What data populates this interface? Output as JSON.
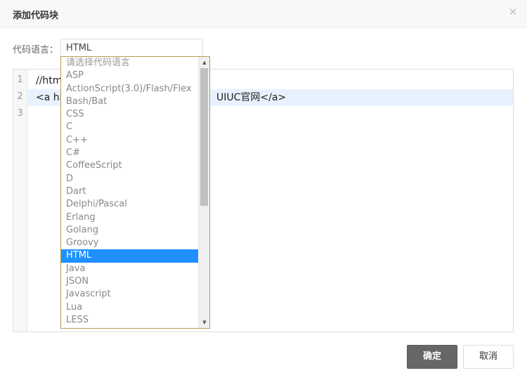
{
  "dialog": {
    "title": "添加代码块",
    "close_glyph": "✕"
  },
  "language": {
    "label": "代码语言：",
    "selected_value": "HTML"
  },
  "editor": {
    "line_numbers": [
      "1",
      "2",
      "3"
    ],
    "lines": [
      "//htm",
      "<a hr",
      ""
    ],
    "line2_tail": "UIUC官网</a>"
  },
  "dropdown": {
    "placeholder": "请选择代码语言",
    "options": [
      "ASP",
      "ActionScript(3.0)/Flash/Flex",
      "Bash/Bat",
      "CSS",
      "C",
      "C++",
      "C#",
      "CoffeeScript",
      "D",
      "Dart",
      "Delphi/Pascal",
      "Erlang",
      "Golang",
      "Groovy",
      "HTML",
      "Java",
      "JSON",
      "Javascript",
      "Lua",
      "LESS"
    ],
    "selected_index": 14,
    "scroll_up_glyph": "▲",
    "scroll_down_glyph": "▼"
  },
  "buttons": {
    "confirm": "确定",
    "cancel": "取消"
  },
  "colors": {
    "selected_option_bg": "#1e90ff",
    "confirm_bg": "#666666",
    "dropdown_border": "#b89a56",
    "active_line_bg": "#e8f2fe"
  }
}
